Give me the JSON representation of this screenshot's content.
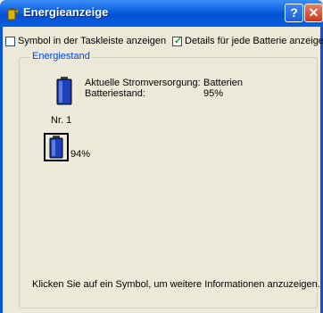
{
  "window": {
    "title": "Energieanzeige",
    "help_glyph": "?",
    "close_glyph": "✕"
  },
  "options": {
    "taskbar_label": "Symbol in der Taskleiste anzeigen",
    "taskbar_checked": false,
    "details_label": "Details für jede Batterie anzeigen",
    "details_checked": true
  },
  "group": {
    "legend": "Energiestand",
    "supply_label": "Aktuelle Stromversorgung:",
    "supply_value": "Batterien",
    "level_label": "Batteriestand:",
    "level_value": "95%"
  },
  "battery": {
    "name": "Nr. 1",
    "percent": "94%"
  },
  "hint": "Klicken Sie auf ein Symbol, um weitere Informationen anzuzeigen.",
  "colors": {
    "title_bar": "#0a5fe0",
    "group_legend": "#0046d5",
    "battery_blue": "#1d3fb8"
  },
  "icons": {
    "title": "battery-meter-icon",
    "summary": "battery-icon",
    "detail": "battery-icon"
  }
}
